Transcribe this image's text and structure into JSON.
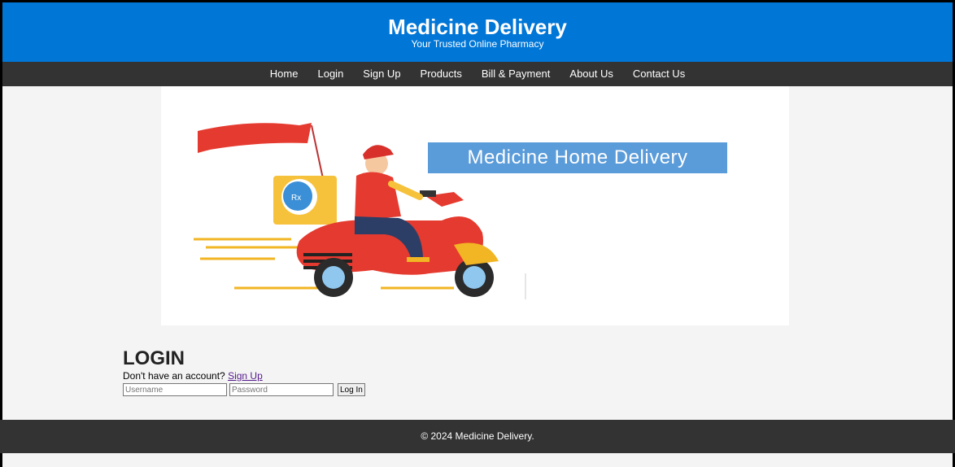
{
  "header": {
    "title": "Medicine Delivery",
    "subtitle": "Your Trusted Online Pharmacy"
  },
  "nav": {
    "items": [
      "Home",
      "Login",
      "Sign Up",
      "Products",
      "Bill & Payment",
      "About Us",
      "Contact Us"
    ]
  },
  "banner": {
    "caption": "Medicine Home Delivery",
    "image": "delivery-scooter-illustration"
  },
  "login": {
    "heading": "LOGIN",
    "note": "Don't have an account?",
    "signup_link": "Sign Up",
    "username_placeholder": "Username",
    "password_placeholder": "Password",
    "submit_label": "Log In"
  },
  "footer": {
    "text": "© 2024 Medicine Delivery."
  },
  "colors": {
    "header_bg": "#0076d7",
    "nav_bg": "#333333",
    "footer_bg": "#333333",
    "page_bg": "#f4f4f4"
  }
}
